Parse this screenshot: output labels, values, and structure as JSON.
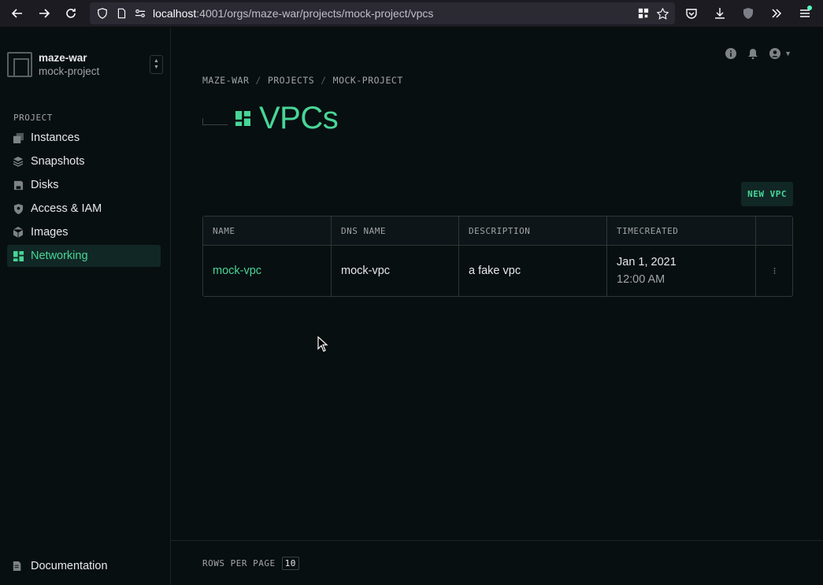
{
  "browser": {
    "url_host": "localhost",
    "url_path": ":4001/orgs/maze-war/projects/mock-project/vpcs"
  },
  "sidebar": {
    "org_name": "maze-war",
    "project_name": "mock-project",
    "section_label": "PROJECT",
    "items": [
      {
        "label": "Instances",
        "icon": "instances-icon"
      },
      {
        "label": "Snapshots",
        "icon": "snapshots-icon"
      },
      {
        "label": "Disks",
        "icon": "disk-icon"
      },
      {
        "label": "Access & IAM",
        "icon": "shield-icon"
      },
      {
        "label": "Images",
        "icon": "images-icon"
      },
      {
        "label": "Networking",
        "icon": "networking-icon",
        "active": true
      }
    ],
    "docs_label": "Documentation"
  },
  "breadcrumb": {
    "org": "MAZE-WAR",
    "projects": "PROJECTS",
    "project": "MOCK-PROJECT",
    "separator": "/"
  },
  "page": {
    "title": "VPCs",
    "new_button": "NEW VPC"
  },
  "table": {
    "headers": [
      "NAME",
      "DNS NAME",
      "DESCRIPTION",
      "TIMECREATED"
    ],
    "rows": [
      {
        "name": "mock-vpc",
        "dns_name": "mock-vpc",
        "description": "a fake vpc",
        "date": "Jan 1, 2021",
        "time": "12:00 AM"
      }
    ]
  },
  "footer": {
    "rows_label": "ROWS PER PAGE",
    "rows_value": "10"
  },
  "colors": {
    "accent": "#48d597",
    "background": "#080f11"
  }
}
